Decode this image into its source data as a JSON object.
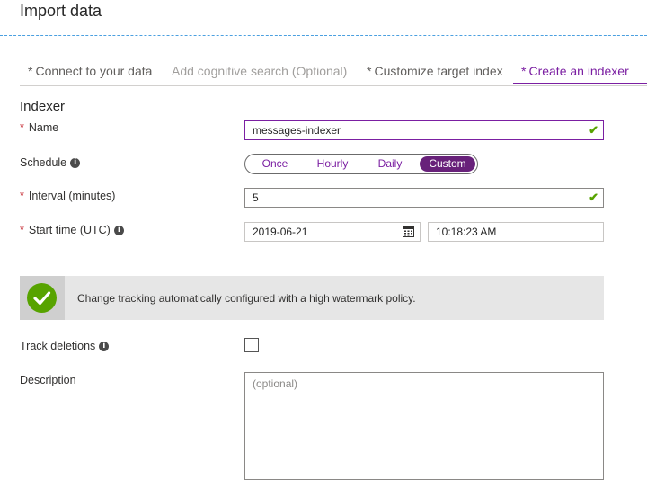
{
  "page": {
    "title": "Import data"
  },
  "tabs": [
    {
      "prefix": "*",
      "label": "Connect to your data",
      "state": "done"
    },
    {
      "prefix": "",
      "label": "Add cognitive search (Optional)",
      "state": "disabled"
    },
    {
      "prefix": "*",
      "label": "Customize target index",
      "state": "done"
    },
    {
      "prefix": "*",
      "label": "Create an indexer",
      "state": "active"
    }
  ],
  "section_title": "Indexer",
  "form": {
    "required_marker": "*",
    "name": {
      "label": "Name",
      "value": "messages-indexer"
    },
    "schedule": {
      "label": "Schedule",
      "options": [
        "Once",
        "Hourly",
        "Daily",
        "Custom"
      ],
      "selected": "Custom"
    },
    "interval": {
      "label": "Interval (minutes)",
      "value": "5"
    },
    "start_time": {
      "label": "Start time (UTC)",
      "date": "2019-06-21",
      "time": "10:18:23 AM"
    },
    "info_glyph": "i",
    "track_deletions": {
      "label": "Track deletions",
      "checked": false
    },
    "description": {
      "label": "Description",
      "placeholder": "(optional)",
      "value": ""
    }
  },
  "banner": {
    "text": "Change tracking automatically configured with a high watermark policy.",
    "icon": "checkmark-circle-icon"
  },
  "colors": {
    "accent": "#7b1fa2",
    "success": "#57a300",
    "required": "#c4262e"
  }
}
